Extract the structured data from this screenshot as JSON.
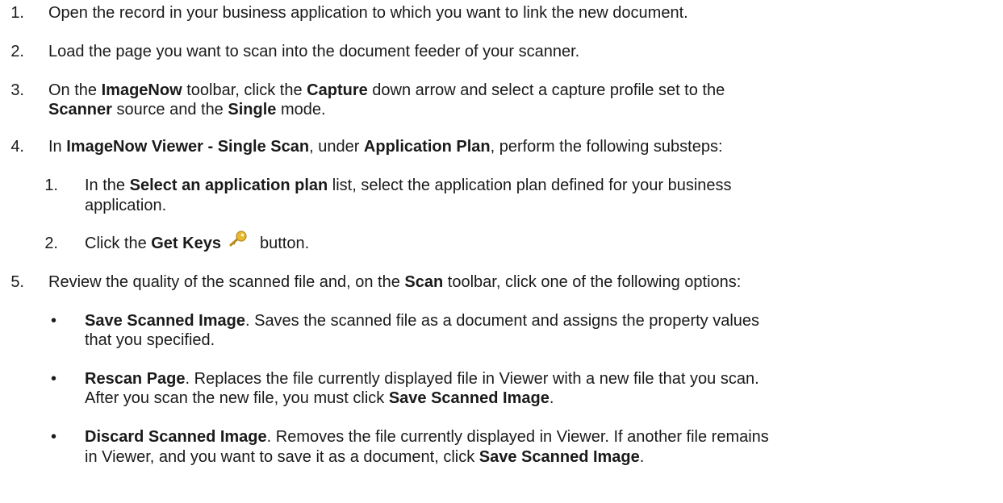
{
  "steps": [
    {
      "num": "1.",
      "lines": [
        [
          {
            "t": "Open the record in your business application to which you want to link the new document."
          }
        ]
      ]
    },
    {
      "num": "2.",
      "lines": [
        [
          {
            "t": "Load the page you want to scan into the document feeder of your scanner."
          }
        ]
      ]
    },
    {
      "num": "3.",
      "lines": [
        [
          {
            "t": "On the "
          },
          {
            "t": "ImageNow",
            "b": 1
          },
          {
            "t": " toolbar, click the "
          },
          {
            "t": "Capture",
            "b": 1
          },
          {
            "t": " down arrow and select a capture profile set to the"
          }
        ],
        [
          {
            "t": "Scanner",
            "b": 1
          },
          {
            "t": " source and the "
          },
          {
            "t": "Single",
            "b": 1
          },
          {
            "t": " mode."
          }
        ]
      ]
    },
    {
      "num": "4.",
      "lines": [
        [
          {
            "t": "In "
          },
          {
            "t": "ImageNow Viewer - Single Scan",
            "b": 1
          },
          {
            "t": ", under "
          },
          {
            "t": "Application Plan",
            "b": 1
          },
          {
            "t": ", perform the following substeps:"
          }
        ]
      ],
      "substeps": [
        {
          "num": "1.",
          "lines": [
            [
              {
                "t": "In the "
              },
              {
                "t": "Select an application plan",
                "b": 1
              },
              {
                "t": " list, select the application plan defined for your business"
              }
            ],
            [
              {
                "t": "application."
              }
            ]
          ]
        },
        {
          "num": "2.",
          "lines": [
            [
              {
                "t": "Click the "
              },
              {
                "t": "Get Keys",
                "b": 1
              },
              {
                "icon": "key-icon"
              },
              {
                "t": "button."
              }
            ]
          ]
        }
      ]
    },
    {
      "num": "5.",
      "lines": [
        [
          {
            "t": "Review the quality of the scanned file and, on the "
          },
          {
            "t": "Scan",
            "b": 1
          },
          {
            "t": " toolbar, click one of the following options:"
          }
        ]
      ],
      "bullets": [
        {
          "marker": "•",
          "lines": [
            [
              {
                "t": "Save Scanned Image",
                "b": 1
              },
              {
                "t": ". Saves the scanned file as a document and assigns the property values"
              }
            ],
            [
              {
                "t": "that you specified."
              }
            ]
          ]
        },
        {
          "marker": "•",
          "lines": [
            [
              {
                "t": "Rescan Page",
                "b": 1
              },
              {
                "t": ". Replaces the file currently displayed file in Viewer with a new file that you scan."
              }
            ],
            [
              {
                "t": "After you scan the new file, you must click "
              },
              {
                "t": "Save Scanned Image",
                "b": 1
              },
              {
                "t": "."
              }
            ]
          ]
        },
        {
          "marker": "•",
          "lines": [
            [
              {
                "t": "Discard Scanned Image",
                "b": 1
              },
              {
                "t": ". Removes the file currently displayed in Viewer. If another file remains"
              }
            ],
            [
              {
                "t": "in Viewer, and you want to save it as a document, click "
              },
              {
                "t": "Save Scanned Image",
                "b": 1
              },
              {
                "t": "."
              }
            ]
          ]
        }
      ]
    }
  ]
}
